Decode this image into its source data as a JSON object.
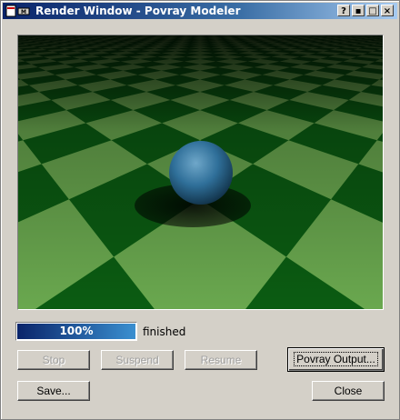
{
  "window": {
    "title": "Render Window - Povray Modeler"
  },
  "titlebar_buttons": {
    "help": "?",
    "minimize": "▪",
    "maximize": "□",
    "close": "×"
  },
  "render": {
    "scene": "checkered plane with blue sphere",
    "colors": {
      "dark": "#0b5c12",
      "light": "#6aa84f",
      "sphere": "#2f6f99"
    }
  },
  "progress": {
    "percent_label": "100%",
    "fraction": 1.0,
    "status": "finished"
  },
  "buttons": {
    "stop": "Stop",
    "suspend": "Suspend",
    "resume": "Resume",
    "povray_output": "Povray Output...",
    "save": "Save...",
    "close": "Close"
  }
}
